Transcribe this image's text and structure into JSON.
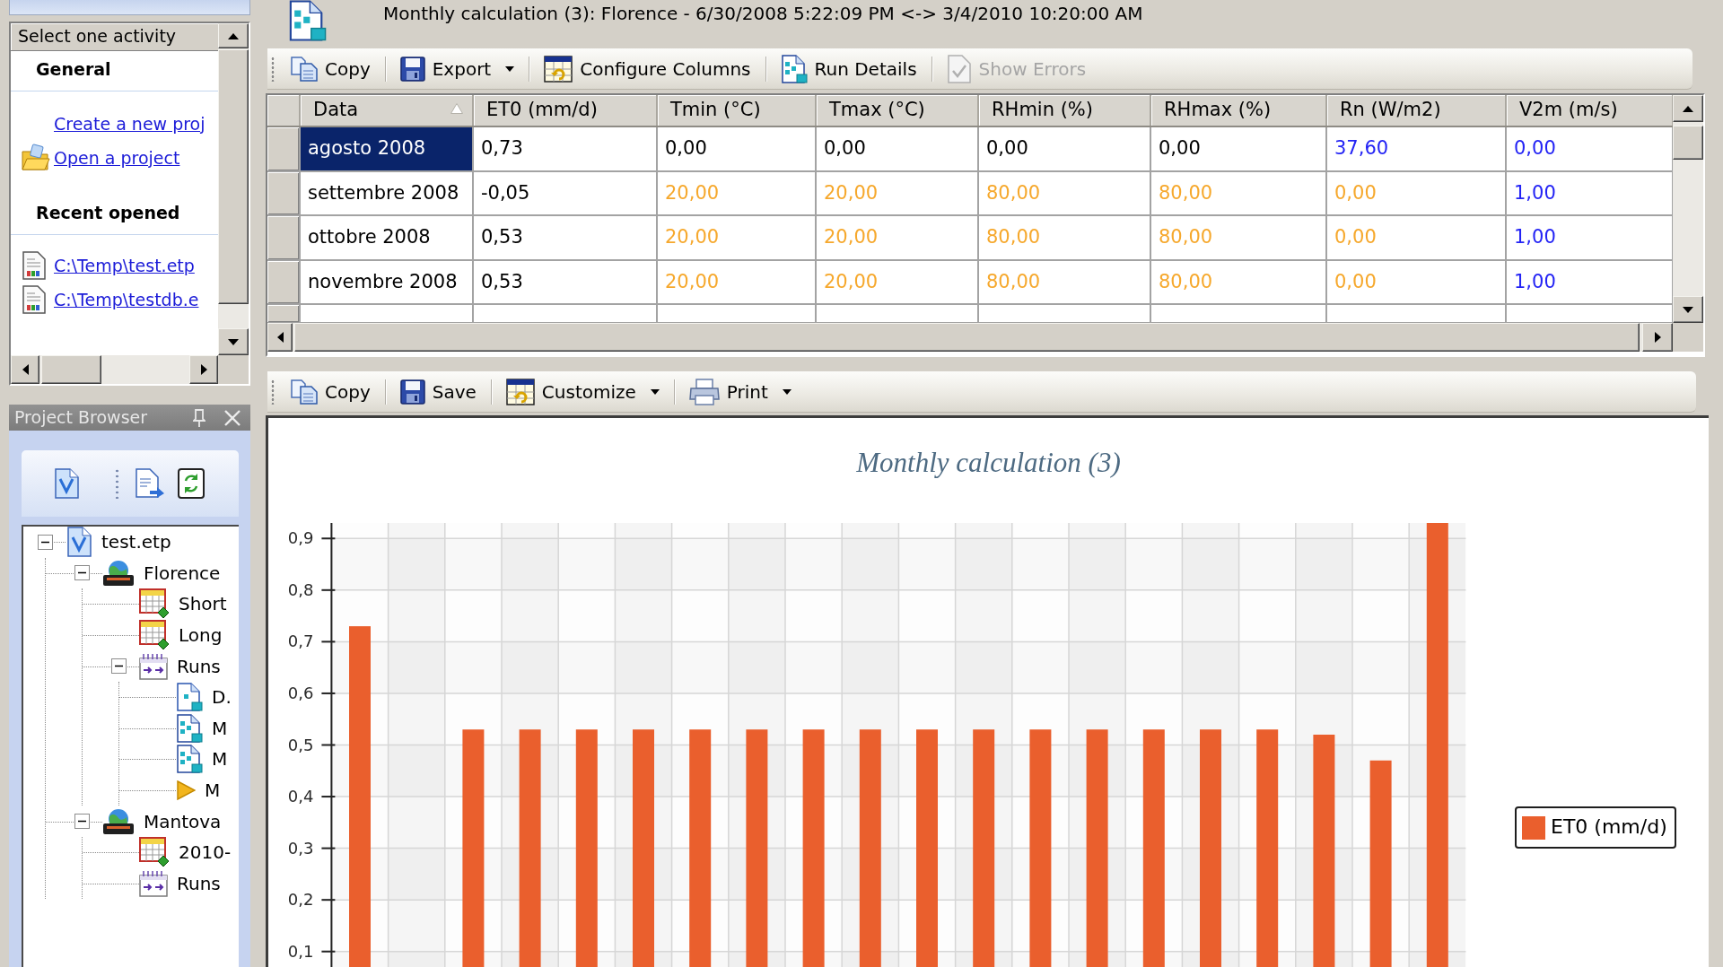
{
  "activity_panel": {
    "header": "Select one activity",
    "sections": [
      {
        "title": "General",
        "links": [
          {
            "text": "Create a new proj",
            "kind": "new"
          },
          {
            "text": "Open a project",
            "kind": "open"
          }
        ]
      },
      {
        "title": "Recent opened",
        "links": [
          {
            "text": "C:\\Temp\\test.etp",
            "kind": "recent"
          },
          {
            "text": "C:\\Temp\\testdb.e",
            "kind": "recent"
          }
        ]
      }
    ]
  },
  "project_browser": {
    "title": "Project Browser",
    "tree": [
      {
        "label": "test.etp",
        "kind": "project",
        "expanded": true,
        "children": [
          {
            "label": "Florence",
            "kind": "station",
            "expanded": true,
            "children": [
              {
                "label": "Short",
                "kind": "table"
              },
              {
                "label": "Long",
                "kind": "table"
              },
              {
                "label": "Runs",
                "kind": "runs",
                "expanded": true,
                "children": [
                  {
                    "label": "D.",
                    "kind": "doc"
                  },
                  {
                    "label": "M",
                    "kind": "grid-doc"
                  },
                  {
                    "label": "M",
                    "kind": "grid-doc"
                  },
                  {
                    "label": "M",
                    "kind": "triangle"
                  }
                ]
              }
            ]
          },
          {
            "label": "Mantova",
            "kind": "station",
            "expanded": true,
            "children": [
              {
                "label": "2010-",
                "kind": "table"
              },
              {
                "label": "Runs",
                "kind": "runs"
              }
            ]
          }
        ]
      }
    ]
  },
  "document": {
    "title": "Monthly calculation (3): Florence - 6/30/2008 5:22:09 PM <-> 3/4/2010 10:20:00 AM",
    "grid_toolbar": [
      {
        "label": "Copy",
        "kind": "copy",
        "dropdown": false,
        "disabled": false
      },
      {
        "label": "Export",
        "kind": "export",
        "dropdown": true,
        "disabled": false
      },
      {
        "label": "Configure Columns",
        "kind": "configure",
        "dropdown": false,
        "disabled": false
      },
      {
        "label": "Run Details",
        "kind": "details",
        "dropdown": false,
        "disabled": false
      },
      {
        "label": "Show Errors",
        "kind": "errors",
        "dropdown": false,
        "disabled": true
      }
    ],
    "grid": {
      "columns": [
        {
          "label": "Data",
          "sorted": true
        },
        {
          "label": "ET0 (mm/d)",
          "sorted": false
        },
        {
          "label": "Tmin (°C)",
          "sorted": false
        },
        {
          "label": "Tmax (°C)",
          "sorted": false
        },
        {
          "label": "RHmin (%)",
          "sorted": false
        },
        {
          "label": "RHmax (%)",
          "sorted": false
        },
        {
          "label": "Rn (W/m2)",
          "sorted": false
        },
        {
          "label": "V2m (m/s)",
          "sorted": false
        }
      ],
      "rows": [
        {
          "date": "agosto 2008",
          "selected": true,
          "values": [
            {
              "text": "0,73",
              "color": "#000000"
            },
            {
              "text": "0,00",
              "color": "#000000"
            },
            {
              "text": "0,00",
              "color": "#000000"
            },
            {
              "text": "0,00",
              "color": "#000000"
            },
            {
              "text": "0,00",
              "color": "#000000"
            },
            {
              "text": "37,60",
              "color": "#2323f5"
            },
            {
              "text": "0,00",
              "color": "#2323f5"
            }
          ]
        },
        {
          "date": "settembre 2008",
          "selected": false,
          "values": [
            {
              "text": "-0,05",
              "color": "#000000"
            },
            {
              "text": "20,00",
              "color": "#f6a82c"
            },
            {
              "text": "20,00",
              "color": "#f6a82c"
            },
            {
              "text": "80,00",
              "color": "#f6a82c"
            },
            {
              "text": "80,00",
              "color": "#f6a82c"
            },
            {
              "text": "0,00",
              "color": "#f6a82c"
            },
            {
              "text": "1,00",
              "color": "#2323f5"
            }
          ]
        },
        {
          "date": "ottobre 2008",
          "selected": false,
          "values": [
            {
              "text": "0,53",
              "color": "#000000"
            },
            {
              "text": "20,00",
              "color": "#f6a82c"
            },
            {
              "text": "20,00",
              "color": "#f6a82c"
            },
            {
              "text": "80,00",
              "color": "#f6a82c"
            },
            {
              "text": "80,00",
              "color": "#f6a82c"
            },
            {
              "text": "0,00",
              "color": "#f6a82c"
            },
            {
              "text": "1,00",
              "color": "#2323f5"
            }
          ]
        },
        {
          "date": "novembre 2008",
          "selected": false,
          "values": [
            {
              "text": "0,53",
              "color": "#000000"
            },
            {
              "text": "20,00",
              "color": "#f6a82c"
            },
            {
              "text": "20,00",
              "color": "#f6a82c"
            },
            {
              "text": "80,00",
              "color": "#f6a82c"
            },
            {
              "text": "80,00",
              "color": "#f6a82c"
            },
            {
              "text": "0,00",
              "color": "#f6a82c"
            },
            {
              "text": "1,00",
              "color": "#2323f5"
            }
          ]
        }
      ]
    },
    "chart_toolbar": [
      {
        "label": "Copy",
        "kind": "copy",
        "dropdown": false,
        "disabled": false
      },
      {
        "label": "Save",
        "kind": "save",
        "dropdown": false,
        "disabled": false
      },
      {
        "label": "Customize",
        "kind": "customize",
        "dropdown": true,
        "disabled": false
      },
      {
        "label": "Print",
        "kind": "print",
        "dropdown": true,
        "disabled": false
      }
    ],
    "chart": {
      "chart_data": {
        "type": "bar",
        "title": "Monthly calculation (3)",
        "series": [
          {
            "name": "ET0 (mm/d)",
            "color": "#ea5f2d",
            "values": [
              0.73,
              null,
              0.53,
              0.53,
              0.53,
              0.53,
              0.53,
              0.53,
              0.53,
              0.53,
              0.53,
              0.53,
              0.53,
              0.53,
              0.53,
              0.53,
              0.53,
              0.52,
              0.47,
              0.93
            ]
          }
        ],
        "ylim": [
          0.07,
          0.93
        ],
        "yticks": [
          {
            "value": 0.9,
            "label": "0,9"
          },
          {
            "value": 0.8,
            "label": "0,8"
          },
          {
            "value": 0.7,
            "label": "0,7"
          },
          {
            "value": 0.6,
            "label": "0,6"
          },
          {
            "value": 0.5,
            "label": "0,5"
          },
          {
            "value": 0.4,
            "label": "0,4"
          },
          {
            "value": 0.3,
            "label": "0,3"
          },
          {
            "value": 0.2,
            "label": "0,2"
          },
          {
            "value": 0.1,
            "label": "0,1"
          }
        ],
        "grid": true
      }
    }
  }
}
